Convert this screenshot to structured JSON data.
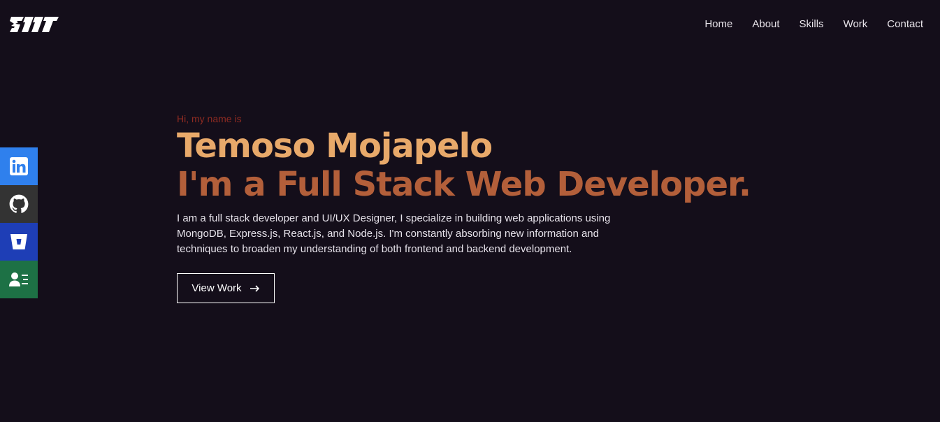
{
  "header": {
    "logo_icon": "tmm-logo",
    "nav": [
      {
        "label": "Home"
      },
      {
        "label": "About"
      },
      {
        "label": "Skills"
      },
      {
        "label": "Work"
      },
      {
        "label": "Contact"
      }
    ]
  },
  "social": [
    {
      "icon": "linkedin-icon",
      "color": "#2f80ed"
    },
    {
      "icon": "github-icon",
      "color": "#333333"
    },
    {
      "icon": "bitbucket-icon",
      "color": "#1e3eb6"
    },
    {
      "icon": "resume-icon",
      "color": "#1d7145"
    }
  ],
  "hero": {
    "greeting": "Hi, my name is",
    "name": "Temoso Mojapelo",
    "tagline": "I'm a Full Stack Web Developer.",
    "bio": "I am a full stack developer and UI/UX Designer, I specialize in building web applications using MongoDB, Express.js, React.js, and Node.js. I'm constantly absorbing new information and techniques to broaden my understanding of both frontend and backend development.",
    "cta_label": "View Work",
    "cta_icon": "arrow-right-icon"
  },
  "colors": {
    "background": "#140e1a",
    "greeting": "#8e2b22",
    "name": "#e8a96a",
    "tagline": "#b35f3a"
  }
}
